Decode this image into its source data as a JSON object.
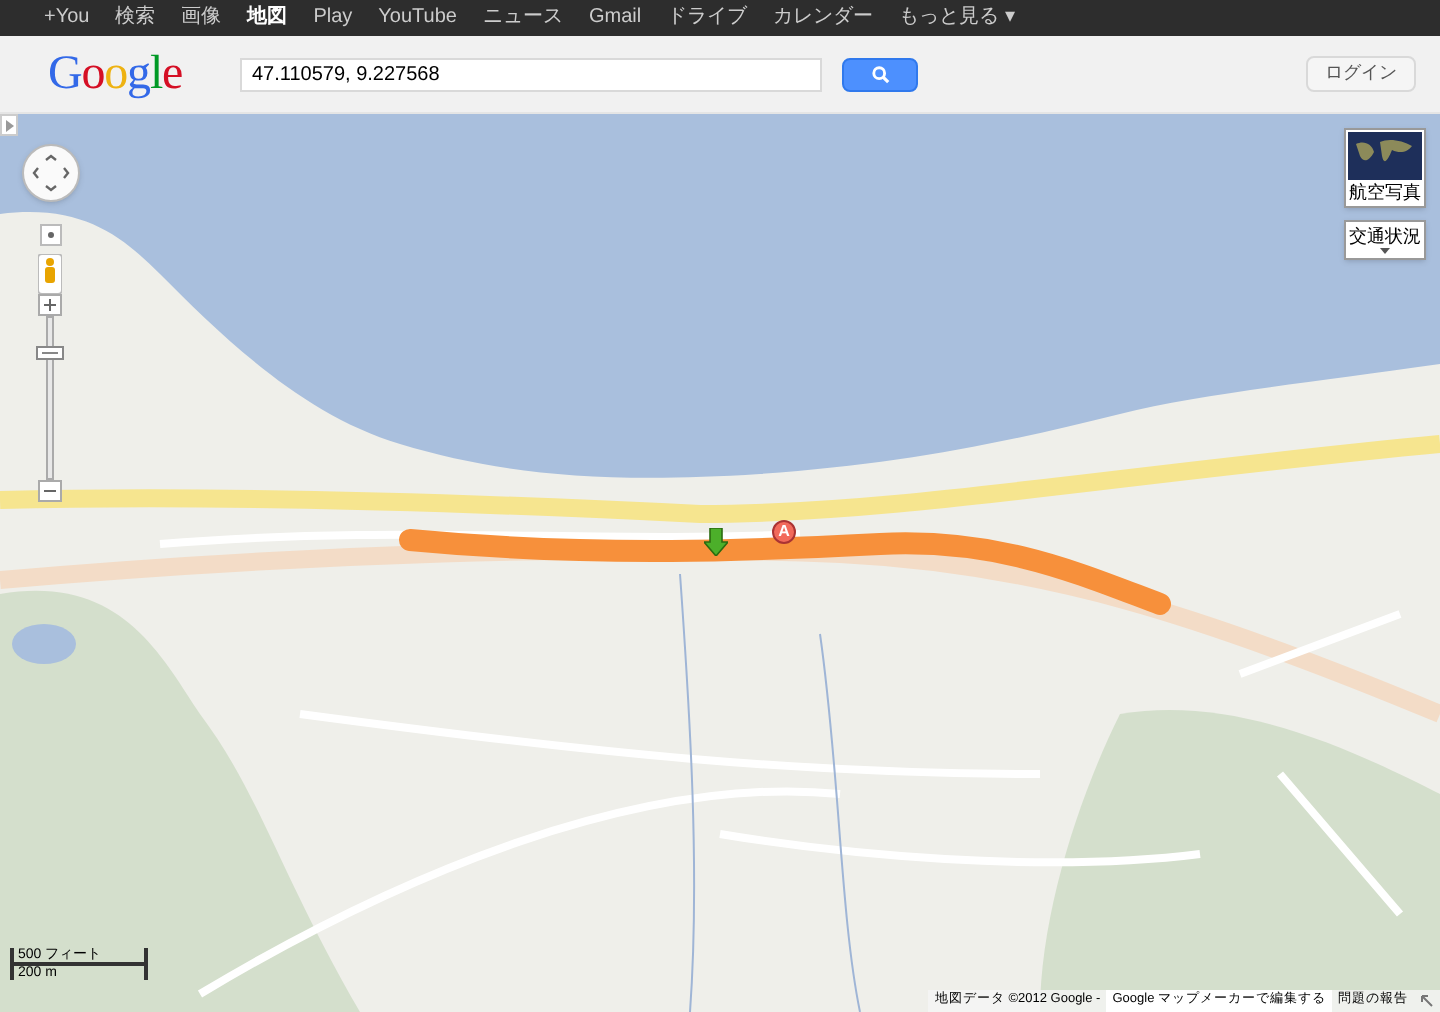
{
  "top_nav": [
    {
      "label": "+You",
      "selected": false
    },
    {
      "label": "検索",
      "selected": false
    },
    {
      "label": "画像",
      "selected": false
    },
    {
      "label": "地図",
      "selected": true
    },
    {
      "label": "Play",
      "selected": false
    },
    {
      "label": "YouTube",
      "selected": false
    },
    {
      "label": "ニュース",
      "selected": false
    },
    {
      "label": "Gmail",
      "selected": false
    },
    {
      "label": "ドライブ",
      "selected": false
    },
    {
      "label": "カレンダー",
      "selected": false
    },
    {
      "label": "もっと見る ▾",
      "selected": false
    }
  ],
  "logo": "Google",
  "search": {
    "value": "47.110579, 9.227568"
  },
  "login_button": "ログイン",
  "map": {
    "layer_buttons": [
      {
        "label": "航空写真",
        "kind": "thumbnail"
      },
      {
        "label": "交通状況",
        "kind": "dropdown"
      }
    ],
    "zoom": {
      "level": 0.8
    },
    "marker_label": "A",
    "scale": {
      "imperial": "500 フィート",
      "metric": "200 m"
    },
    "footer": {
      "copyright": "地図データ ©2012 Google -",
      "edit_link": "Google マップメーカーで編集する",
      "report_link": "問題の報告"
    }
  }
}
